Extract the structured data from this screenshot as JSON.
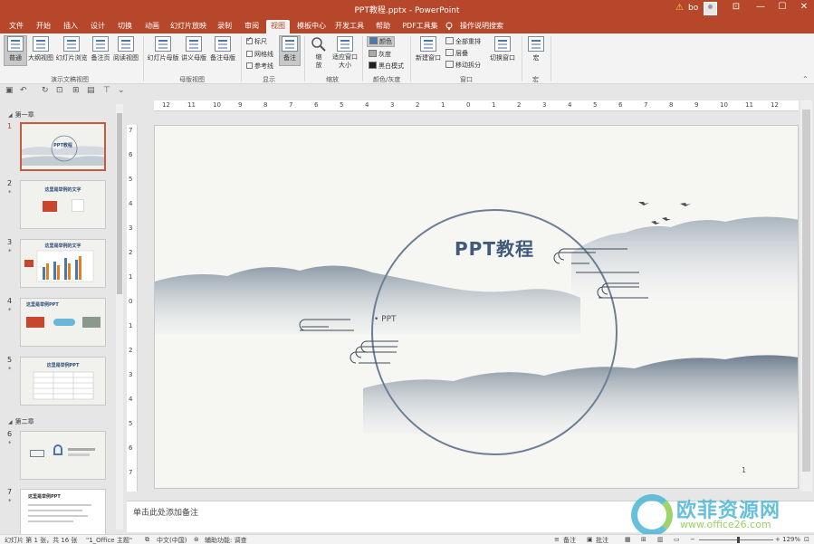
{
  "titlebar": {
    "title": "PPT教程.pptx - PowerPoint",
    "user": "bo",
    "warn_icon": "⚠",
    "ribbon_display": "⊡",
    "minimize": "—",
    "maximize": "☐",
    "close": "✕"
  },
  "tabs": [
    "文件",
    "开始",
    "插入",
    "设计",
    "切换",
    "动画",
    "幻灯片放映",
    "录制",
    "审阅",
    "视图",
    "模板中心",
    "开发工具",
    "帮助",
    "PDF工具集"
  ],
  "active_tab": "视图",
  "tell_me": "操作说明搜索",
  "ribbon": {
    "presentation_views": [
      "普通",
      "大纲视图",
      "幻灯片浏览",
      "备注页",
      "阅读视图"
    ],
    "master_views": [
      "幻灯片母版",
      "讲义母版",
      "备注母版"
    ],
    "show": {
      "ruler": "标尺",
      "gridlines": "网格线",
      "guides": "参考线",
      "notes": "备注"
    },
    "zoom": {
      "zoom": "缩放",
      "fit": "适应窗口大小"
    },
    "color": {
      "color": "颜色",
      "grayscale": "灰度",
      "bw": "黑白模式"
    },
    "window": {
      "new_window": "新建窗口",
      "arrange_all": "全部重排",
      "cascade": "层叠",
      "move_split": "移动拆分",
      "switch_window": "切换窗口"
    },
    "macros": "宏",
    "groups": {
      "presentation_views": "演示文稿视图",
      "master_views": "母版视图",
      "show": "显示",
      "zoom": "缩放",
      "color": "颜色/灰度",
      "window": "窗口",
      "macros": "宏"
    }
  },
  "ruler_h": [
    "12",
    "11",
    "10",
    "9",
    "8",
    "7",
    "6",
    "5",
    "4",
    "3",
    "2",
    "1",
    "0",
    "1",
    "2",
    "3",
    "4",
    "5",
    "6",
    "7",
    "8",
    "9",
    "10",
    "11",
    "12"
  ],
  "ruler_v": [
    "7",
    "6",
    "5",
    "4",
    "3",
    "2",
    "1",
    "0",
    "1",
    "2",
    "3",
    "4",
    "5",
    "6",
    "7"
  ],
  "sections": {
    "s1": "第一章",
    "s2": "第二章"
  },
  "thumbnails": [
    {
      "num": "1",
      "title": "PPT教程",
      "star": ""
    },
    {
      "num": "2",
      "title": "这里是举例的文字",
      "star": "*"
    },
    {
      "num": "3",
      "title": "这里是举例的文字",
      "star": "*"
    },
    {
      "num": "4",
      "title": "这里是举例PPT",
      "star": "*"
    },
    {
      "num": "5",
      "title": "这里是举例PPT",
      "star": "*"
    },
    {
      "num": "6",
      "title": "",
      "star": "*"
    },
    {
      "num": "7",
      "title": "这里是举例PPT",
      "star": "*"
    }
  ],
  "slide": {
    "title": "PPT教程",
    "bullet": "PPT",
    "page": "1"
  },
  "notes_placeholder": "单击此处添加备注",
  "status": {
    "slide_info": "幻灯片 第 1 张，共 16 张",
    "theme": "\"1_Office 主题\"",
    "language": "中文(中国)",
    "accessibility": "辅助功能: 调查",
    "notes": "备注",
    "comments": "批注",
    "zoom": "129%"
  },
  "watermark": {
    "cn": "欧菲资源网",
    "url": "www.office26.com"
  },
  "colors": {
    "accent": "#b7472a",
    "slide_bg": "#f6f6f3",
    "title": "#3f5a7a"
  }
}
